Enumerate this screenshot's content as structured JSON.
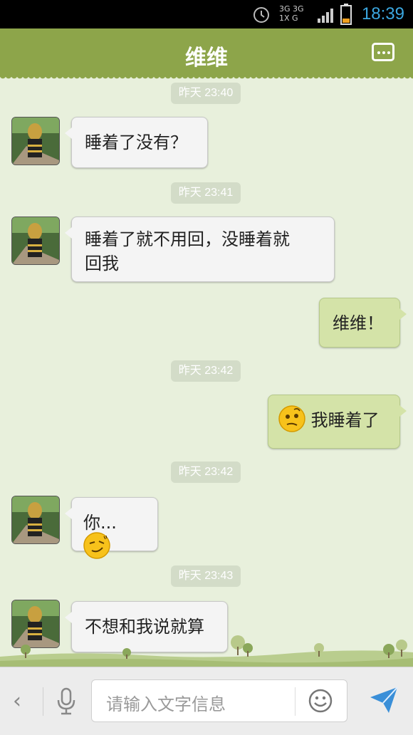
{
  "status_bar": {
    "network_label": "3G 3G 1X G",
    "time": "18:39",
    "icons": [
      "alarm-icon",
      "network-icon",
      "signal-icon",
      "battery-icon"
    ]
  },
  "header": {
    "title": "维维",
    "menu_icon": "more-dots-icon",
    "color": "#8da54a"
  },
  "messages": [
    {
      "type": "timestamp",
      "text": "昨天 23:40"
    },
    {
      "type": "incoming",
      "text": "睡着了没有？"
    },
    {
      "type": "timestamp",
      "text": "昨天 23:41"
    },
    {
      "type": "incoming",
      "line1": "睡着了就不用回，没睡着就",
      "line2": "回我"
    },
    {
      "type": "outgoing",
      "text": "维维！"
    },
    {
      "type": "timestamp",
      "text": "昨天 23:42"
    },
    {
      "type": "outgoing",
      "text": "我睡着了",
      "emoji": "confused-face-icon"
    },
    {
      "type": "timestamp",
      "text": "昨天 23:42"
    },
    {
      "type": "incoming",
      "text": "你...",
      "emoji": "smirk-face-icon"
    },
    {
      "type": "timestamp",
      "text": "昨天 23:43"
    },
    {
      "type": "incoming",
      "text": "不想和我说就算"
    }
  ],
  "input_bar": {
    "back_glyph": "‹",
    "placeholder": "请输入文字信息",
    "icons": [
      "back-icon",
      "microphone-icon",
      "emoji-smile-icon",
      "send-icon"
    ]
  },
  "colors": {
    "chat_background": "#e8f0dc",
    "incoming_bubble": "#f4f4f4",
    "outgoing_bubble": "#d4e3a8",
    "time_accent": "#3ba7e0"
  }
}
